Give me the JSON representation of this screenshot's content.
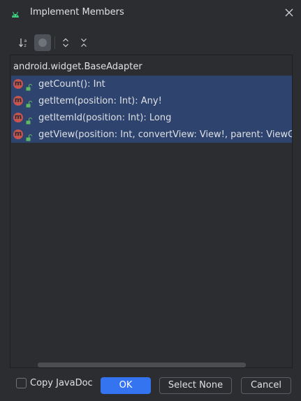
{
  "window": {
    "title": "Implement Members",
    "app_icon": "android-icon",
    "close_icon": "close-icon"
  },
  "toolbar": {
    "buttons": [
      {
        "name": "sort-alphabetically",
        "icon": "sort-az-icon",
        "active": false
      },
      {
        "name": "show-members",
        "icon": "circle-icon",
        "active": true
      },
      {
        "name": "expand-all",
        "icon": "expand-all-icon",
        "active": false
      },
      {
        "name": "collapse-all",
        "icon": "collapse-all-icon",
        "active": false
      }
    ]
  },
  "tree": {
    "root_label": "android.widget.BaseAdapter",
    "members": [
      {
        "label": "getCount(): Int",
        "selected": true
      },
      {
        "label": "getItem(position: Int): Any!",
        "selected": true
      },
      {
        "label": "getItemId(position: Int): Long",
        "selected": true
      },
      {
        "label": "getView(position: Int, convertView: View!, parent: ViewGroup",
        "selected": true
      }
    ],
    "member_icon_letter": "m"
  },
  "footer": {
    "copy_javadoc_label": "Copy JavaDoc",
    "copy_javadoc_checked": false,
    "ok_label": "OK",
    "select_none_label": "Select None",
    "cancel_label": "Cancel"
  },
  "colors": {
    "background": "#2b2d30",
    "selection": "#2e436e",
    "primary_button": "#3574f0",
    "method_icon": "#c75450",
    "android_green": "#3ddc84"
  }
}
